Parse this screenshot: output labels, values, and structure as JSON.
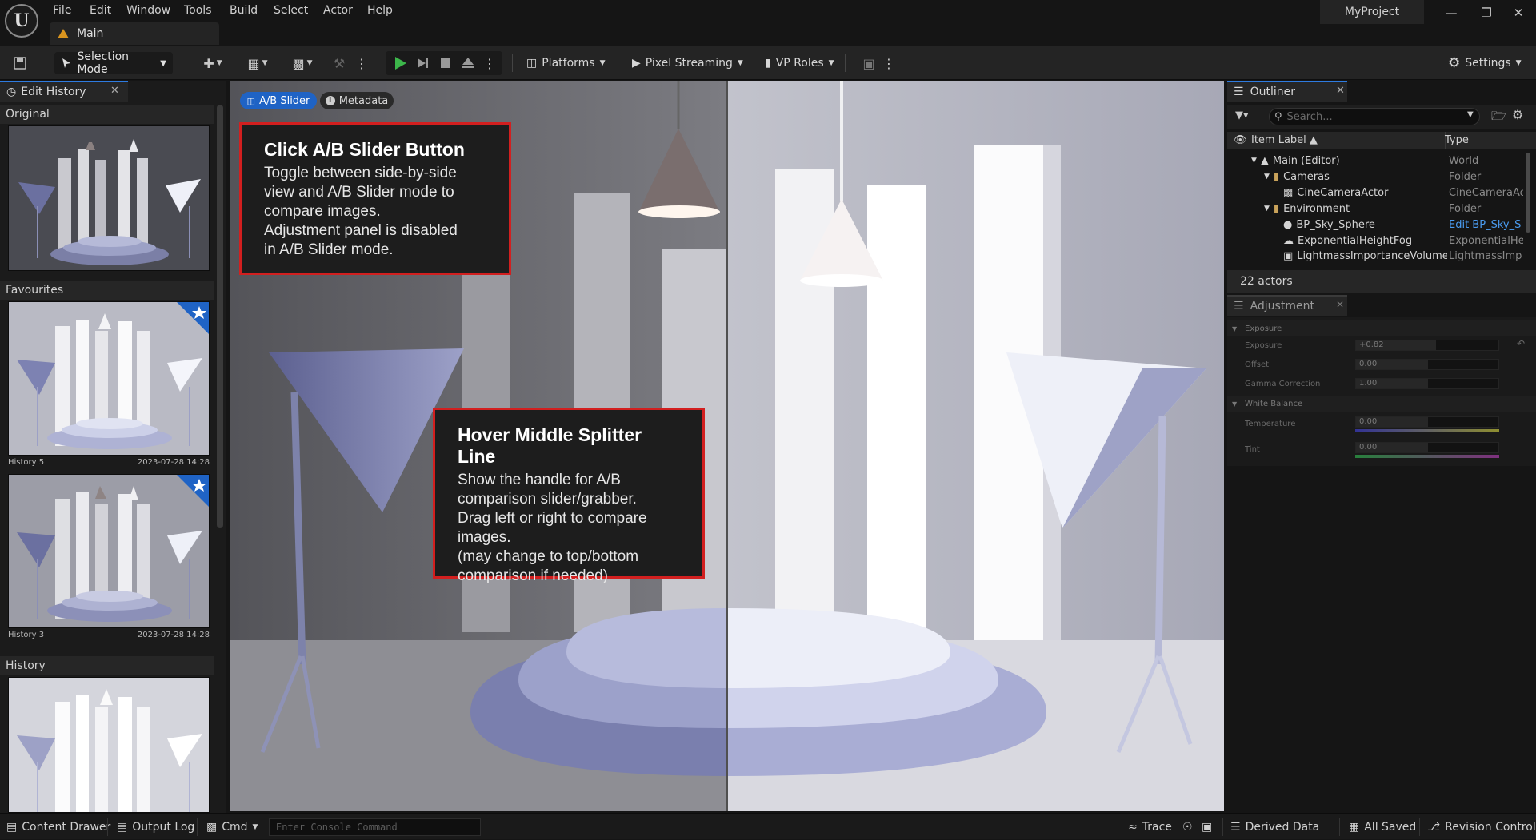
{
  "menu": [
    "File",
    "Edit",
    "Window",
    "Tools",
    "Build",
    "Select",
    "Actor",
    "Help"
  ],
  "tab_main": "Main",
  "project_name": "MyProject",
  "toolbar": {
    "selection_mode": "Selection Mode",
    "platforms": "Platforms",
    "pixel_streaming": "Pixel Streaming",
    "vp_roles": "VP Roles",
    "settings": "Settings"
  },
  "left_panel": {
    "title": "Edit History",
    "original": "Original",
    "favourites": "Favourites",
    "history": "History",
    "fav_items": [
      {
        "name": "History 5",
        "date": "2023-07-28 14:28"
      },
      {
        "name": "History 3",
        "date": "2023-07-28 14:28"
      }
    ]
  },
  "viewport": {
    "ab_slider": "A/B Slider",
    "metadata": "Metadata",
    "callout1_title": "Click A/B Slider Button",
    "callout1_body": "Toggle between side-by-side\nview and A/B Slider mode to\ncompare images.\nAdjustment panel is disabled\nin A/B Slider mode.",
    "callout2_title": "Hover Middle Splitter Line",
    "callout2_body": "Show the handle for A/B\ncomparison slider/grabber.\nDrag left or right to compare\nimages.\n(may change to top/bottom\ncomparison if needed)"
  },
  "outliner": {
    "title": "Outliner",
    "search_placeholder": "Search...",
    "col_label": "Item Label",
    "col_type": "Type",
    "rows": [
      {
        "label": "Main (Editor)",
        "type": "World"
      },
      {
        "label": "Cameras",
        "type": "Folder"
      },
      {
        "label": "CineCameraActor",
        "type": "CineCameraAc"
      },
      {
        "label": "Environment",
        "type": "Folder"
      },
      {
        "label": "BP_Sky_Sphere",
        "type": "Edit BP_Sky_S"
      },
      {
        "label": "ExponentialHeightFog",
        "type": "ExponentialHei"
      },
      {
        "label": "LightmassImportanceVolume",
        "type": "LightmassImp"
      }
    ],
    "actors": "22 actors"
  },
  "adjustment": {
    "title": "Adjustment",
    "exposure_section": "Exposure",
    "exposure_label": "Exposure",
    "exposure_value": "+0.82",
    "offset_label": "Offset",
    "offset_value": "0.00",
    "gamma_label": "Gamma Correction",
    "gamma_value": "1.00",
    "wb_section": "White Balance",
    "temperature_label": "Temperature",
    "temperature_value": "0.00",
    "tint_label": "Tint",
    "tint_value": "0.00"
  },
  "statusbar": {
    "content_drawer": "Content Drawer",
    "output_log": "Output Log",
    "cmd": "Cmd",
    "console_placeholder": "Enter Console Command",
    "trace": "Trace",
    "derived_data": "Derived Data",
    "all_saved": "All Saved",
    "revision_control": "Revision Control"
  },
  "colors": {
    "accent": "#1f63c5",
    "callout_border": "#d21f1f",
    "play_green": "#3cb64a",
    "folder": "#c9a25a"
  }
}
